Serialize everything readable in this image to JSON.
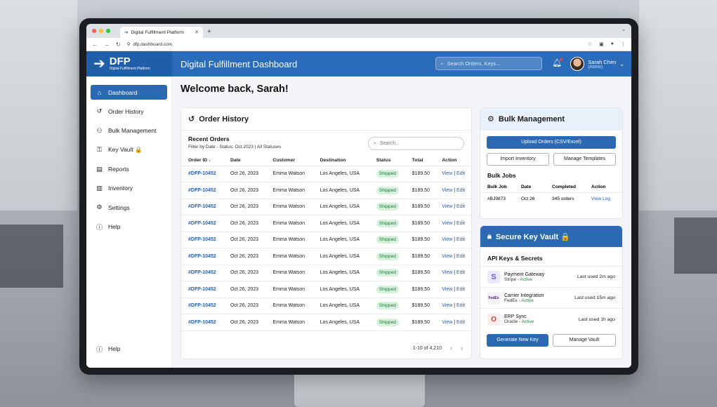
{
  "browser": {
    "tab_title": "Digital Fulfillment Platform",
    "url": "dfp.dashboard.com"
  },
  "brand": {
    "name": "DFP",
    "subtitle": "Digital Fulfillment Platform"
  },
  "header": {
    "title": "Digital Fulfillment Dashboard",
    "search_placeholder": "Search Orders, Keys...",
    "user_name": "Sarah Chen",
    "user_role": "(Admin)"
  },
  "sidebar": {
    "items": [
      {
        "label": "Dashboard",
        "icon": "home-icon"
      },
      {
        "label": "Order History",
        "icon": "history-icon"
      },
      {
        "label": "Bulk Management",
        "icon": "users-icon"
      },
      {
        "label": "Key Vault 🔒",
        "icon": "key-icon"
      },
      {
        "label": "Reports",
        "icon": "report-icon"
      },
      {
        "label": "Inventory",
        "icon": "box-icon"
      },
      {
        "label": "Settings",
        "icon": "gear-icon"
      },
      {
        "label": "Help",
        "icon": "help-icon"
      }
    ],
    "bottom_help": "Help"
  },
  "main": {
    "welcome": "Welcome back, Sarah!",
    "orders": {
      "title": "Order History",
      "subtitle": "Recent Orders",
      "filter": "Filter by Date  -  Status: Oct 2023 | All Statuses",
      "search_placeholder": "Search...",
      "columns": [
        "Order ID",
        "Date",
        "Customer",
        "Destination",
        "Status",
        "Total",
        "Action"
      ],
      "rows": [
        [
          "#DFP-10452",
          "Oct 26, 2023",
          "Emma Watson",
          "Los Angeles, USA",
          "Shipped",
          "$189.50"
        ],
        [
          "#DFP-10452",
          "Oct 26, 2023",
          "Emma Watson",
          "Los Angeles, USA",
          "Shipped",
          "$189.50"
        ],
        [
          "#DFP-10452",
          "Oct 26, 2023",
          "Emma Watson",
          "Los Angeles, USA",
          "Shipped",
          "$189.50"
        ],
        [
          "#DFP-10452",
          "Oct 26, 2023",
          "Emma Watson",
          "Los Angeles, USA",
          "Shipped",
          "$189.50"
        ],
        [
          "#DFP-10452",
          "Oct 26, 2023",
          "Emma Watson",
          "Los Angeles, USA",
          "Shipped",
          "$189.50"
        ],
        [
          "#DFP-10452",
          "Oct 26, 2023",
          "Emma Watson",
          "Los Angeles, USA",
          "Shipped",
          "$189.50"
        ],
        [
          "#DFP-10452",
          "Oct 26, 2023",
          "Emma Watson",
          "Los Angeles, USA",
          "Shipped",
          "$189.50"
        ],
        [
          "#DFP-10452",
          "Oct 26, 2023",
          "Emma Watson",
          "Los Angeles, USA",
          "Shipped",
          "$189.50"
        ],
        [
          "#DFP-10452",
          "Oct 26, 2023",
          "Emma Watson",
          "Los Angeles, USA",
          "Shipped",
          "$189.50"
        ],
        [
          "#DFP-10452",
          "Oct 26, 2023",
          "Emma Watson",
          "Los Angeles, USA",
          "Shipped",
          "$189.50"
        ]
      ],
      "view_label": "View",
      "edit_label": "Edit",
      "pagination": "1-10 of 4,210"
    },
    "bulk": {
      "title": "Bulk Management",
      "upload_label": "Upload Orders (CSV/Excel)",
      "import_label": "Import Inventory",
      "templates_label": "Manage Templates",
      "jobs_title": "Bulk Jobs",
      "columns": [
        "Bulk Job",
        "Date",
        "Completed",
        "Action"
      ],
      "job": {
        "id": "#BJ9873",
        "date": "Oct 26",
        "completed": "345 orders",
        "action": "View Log"
      }
    },
    "vault": {
      "title": "Secure Key Vault 🔒",
      "section_title": "API Keys & Secrets",
      "keys": [
        {
          "name": "Payment Gateway",
          "provider": "Stripe",
          "status": "Active",
          "last_used": "Last used 2m ago",
          "logo": "S"
        },
        {
          "name": "Carrier Integration",
          "provider": "FedEx",
          "status": "Active",
          "last_used": "Last used 15m ago",
          "logo": "FedEx"
        },
        {
          "name": "ERP Sync",
          "provider": "Oracle",
          "status": "Active",
          "last_used": "Last used 1h ago",
          "logo": "O"
        }
      ],
      "generate_label": "Generate New Key",
      "manage_label": "Manage Vault"
    }
  },
  "colors": {
    "primary": "#2b6ab3",
    "success": "#1b8a3c",
    "shipped_bg": "#d6f2dc"
  }
}
